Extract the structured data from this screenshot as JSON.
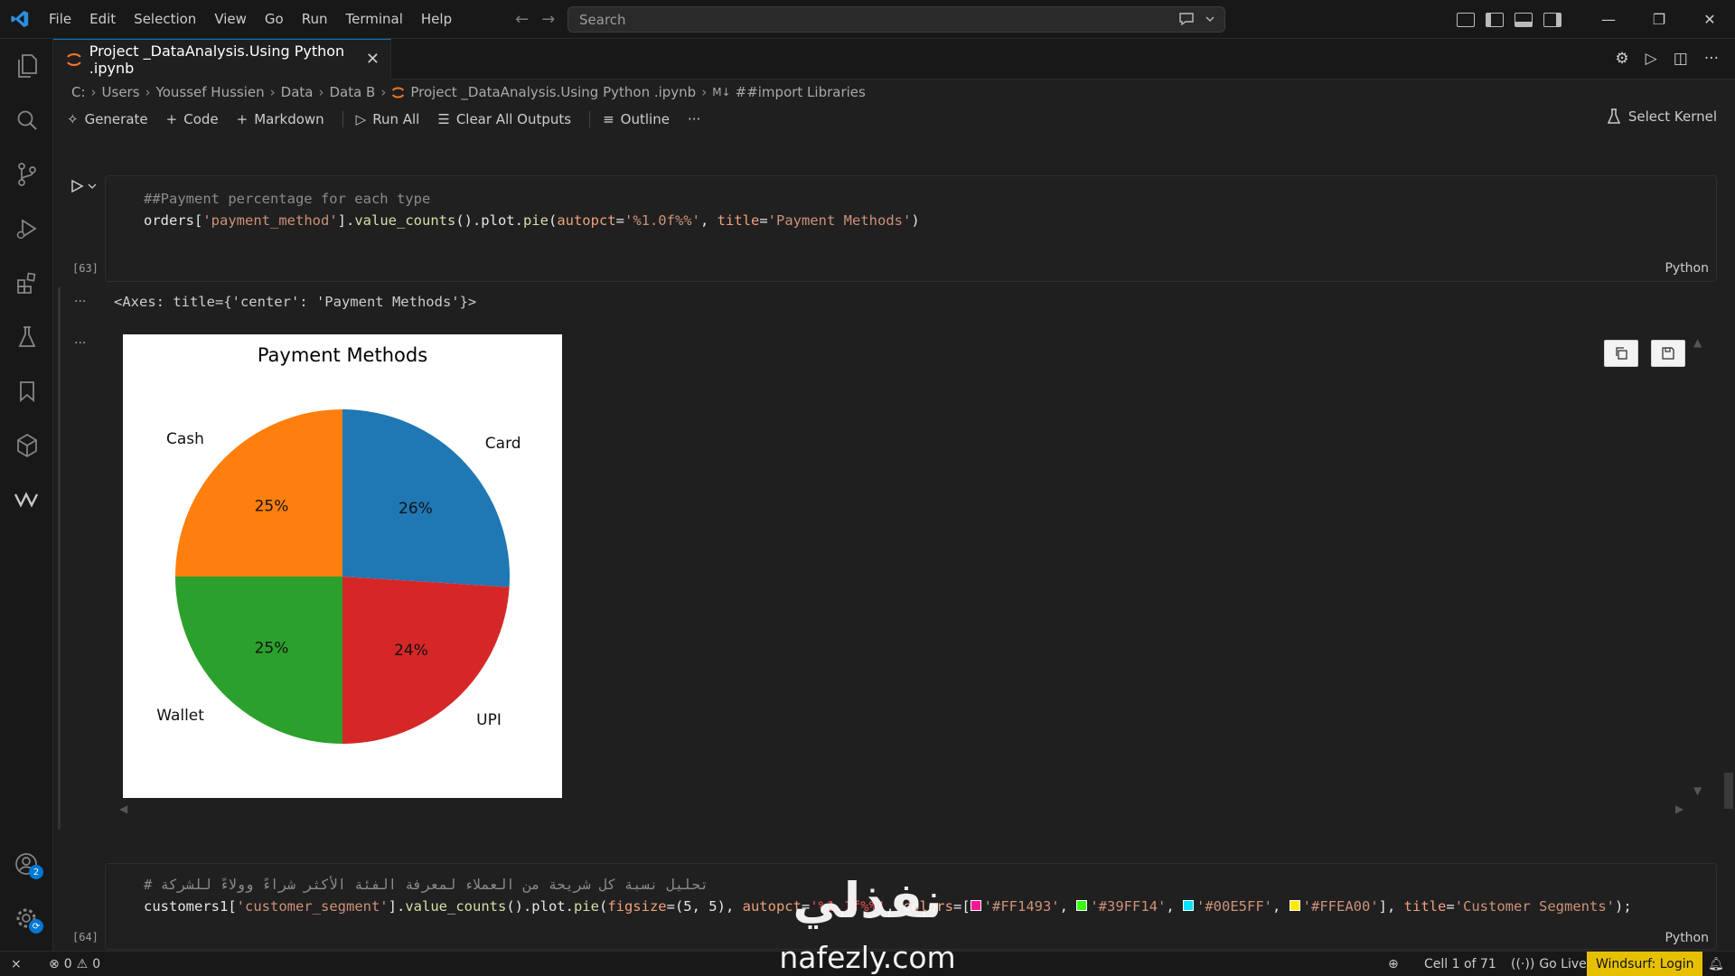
{
  "menu": [
    "File",
    "Edit",
    "Selection",
    "View",
    "Go",
    "Run",
    "Terminal",
    "Help"
  ],
  "search": {
    "placeholder": "Search"
  },
  "tab": {
    "title": "Project _DataAnalysis.Using Python .ipynb"
  },
  "breadcrumb": [
    "C:",
    "Users",
    "Youssef Hussien",
    "Data",
    "Data B",
    "Project _DataAnalysis.Using Python .ipynb",
    "##import Libraries"
  ],
  "toolbar": {
    "generate": "Generate",
    "code": "Code",
    "markdown": "Markdown",
    "run_all": "Run All",
    "clear_outputs": "Clear All Outputs",
    "outline": "Outline",
    "more": "···",
    "select_kernel": "Select Kernel"
  },
  "cell1": {
    "exec_count": "[63]",
    "language": "Python",
    "line1": "##Payment percentage for each type",
    "line2": {
      "var": "orders",
      "b1": "[",
      "key": "'payment_method'",
      "b2": "].",
      "fn1": "value_counts",
      "p1": "().plot.",
      "fn2": "pie",
      "p2": "(",
      "arg1": "autopct",
      "eq1": "=",
      "val1": "'%1.0f%%'",
      "comma": ", ",
      "arg2": "title",
      "eq2": "=",
      "val2": "'Payment Methods'",
      "close": ")"
    }
  },
  "output": {
    "ellipsis1": "···",
    "ellipsis2": "···",
    "text": "<Axes: title={'center': 'Payment Methods'}>"
  },
  "cell2": {
    "exec_count": "[64]",
    "language": "Python",
    "line1": "# تحليل نسبة كل شريحة من العملاء لمعرفة الفئة الأكثر شراءً وولاءً للشركة",
    "line2": {
      "var": "customers1",
      "b1": "[",
      "key": "'customer_segment'",
      "b2": "].",
      "fn1": "value_counts",
      "p1": "().plot.",
      "fn2": "pie",
      "p2": "(",
      "arg1": "figsize",
      "p3": "=(5, 5), ",
      "arg2": "autopct",
      "eq": "=",
      "val1": "'%1.1f%%'",
      "comma": ", ",
      "arg3": "colors",
      "p4": "=[",
      "color1": "'#FF1493'",
      "color2": "'#39FF14'",
      "color3": "'#00E5FF'",
      "color4": "'#FFEA00'",
      "p5": "], ",
      "arg4": "title",
      "eq2": "=",
      "val2": "'Customer Segments'",
      "close": ");"
    },
    "swatches": [
      "#FF1493",
      "#39FF14",
      "#00E5FF",
      "#FFEA00"
    ]
  },
  "chart_data": {
    "type": "pie",
    "title": "Payment Methods",
    "categories": [
      "Card",
      "UPI",
      "Wallet",
      "Cash"
    ],
    "values": [
      26,
      24,
      25,
      25
    ],
    "labels": [
      "26%",
      "24%",
      "25%",
      "25%"
    ],
    "colors": [
      "#1f77b4",
      "#d62728",
      "#2ca02c",
      "#ff7f0e"
    ]
  },
  "statusbar": {
    "errors": "0",
    "warnings": "0",
    "cell_pos": "Cell 1 of 71",
    "go_live": "Go Live",
    "windsurf": "Windsurf: Login"
  },
  "watermark": {
    "arabic": "نفذلي",
    "latin": "nafezly.com"
  },
  "badges": {
    "accounts": "2"
  }
}
